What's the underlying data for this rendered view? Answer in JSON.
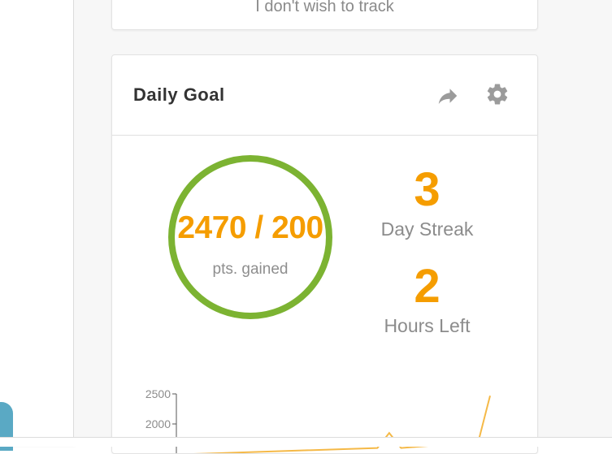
{
  "tracking_card": {
    "option_text": "I don't wish to track"
  },
  "daily_goal": {
    "title": "Daily Goal",
    "share_icon": "share-arrow-icon",
    "settings_icon": "gear-icon",
    "points": {
      "value_text": "2470 / 200",
      "label": "pts. gained"
    },
    "streak": {
      "value": "3",
      "label": "Day Streak"
    },
    "hours_left": {
      "value": "2",
      "label": "Hours Left"
    }
  },
  "colors": {
    "accent_orange": "#f59d00",
    "ring_green": "#7cb332",
    "line_orange": "#f5b947",
    "fab_blue": "#5aa9c4"
  },
  "chart_data": {
    "type": "line",
    "y_ticks": [
      "2500",
      "2000"
    ],
    "series": [
      {
        "x": [
          0.0,
          0.62,
          0.66,
          0.7,
          0.96,
          1.0
        ],
        "values": [
          1500,
          1600,
          1850,
          1600,
          1700,
          2470
        ]
      }
    ]
  }
}
